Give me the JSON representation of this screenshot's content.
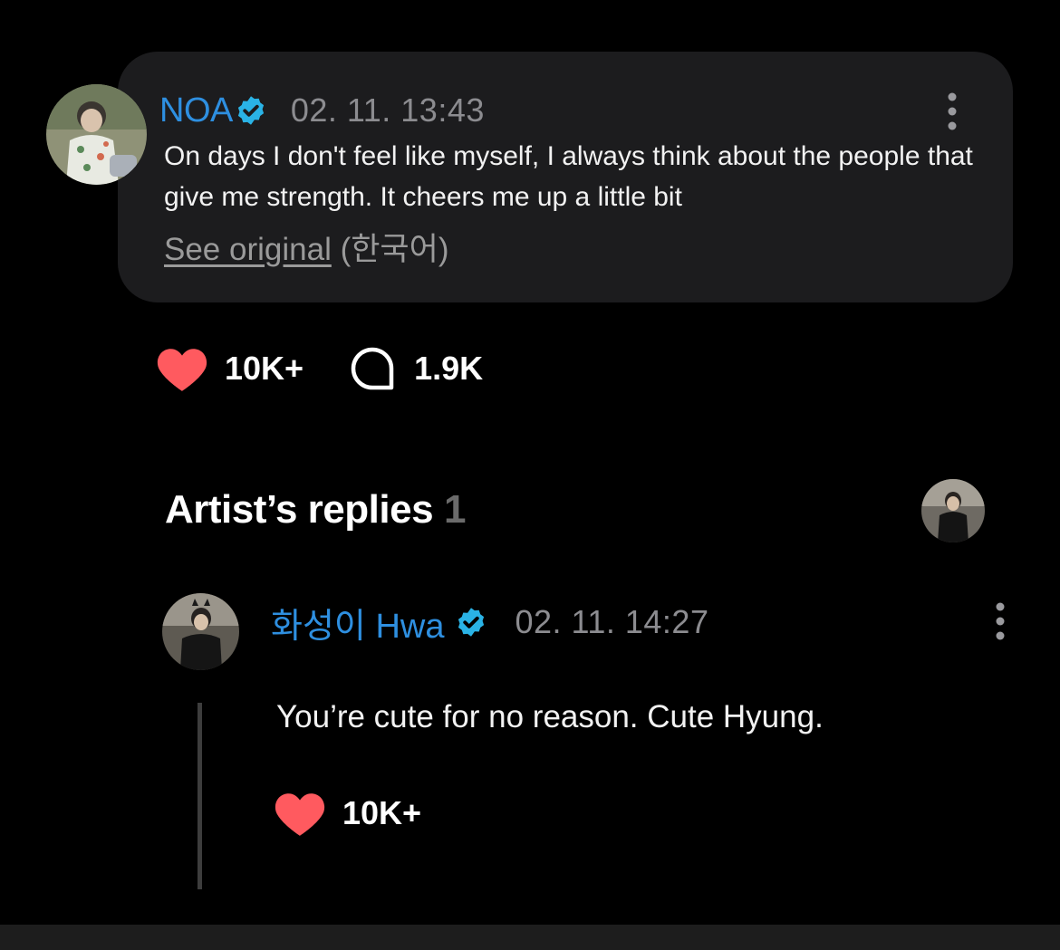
{
  "post": {
    "author": "NOA",
    "timestamp": "02. 11. 13:43",
    "text": "On days I don't feel like myself, I always think about the people that give me strength. It cheers me up a little bit",
    "see_original_label": "See original",
    "original_language": "(한국어)",
    "likes": "10K+",
    "comments": "1.9K"
  },
  "artist_replies": {
    "title": "Artist’s replies",
    "count": "1"
  },
  "reply": {
    "author": "화성이 Hwa",
    "timestamp": "02. 11. 14:27",
    "text": "You’re cute for no reason. Cute Hyung.",
    "likes": "10K+"
  },
  "icons": {
    "verified": "verified-badge-icon",
    "heart": "heart-icon",
    "comment": "comment-bubble-icon",
    "more": "more-vertical-icon"
  },
  "colors": {
    "background": "#000000",
    "card": "#1c1c1e",
    "author_blue": "#2e8fe0",
    "verified": "#2ab3e6",
    "heart": "#ff5a5f",
    "muted": "#8c8c90"
  }
}
